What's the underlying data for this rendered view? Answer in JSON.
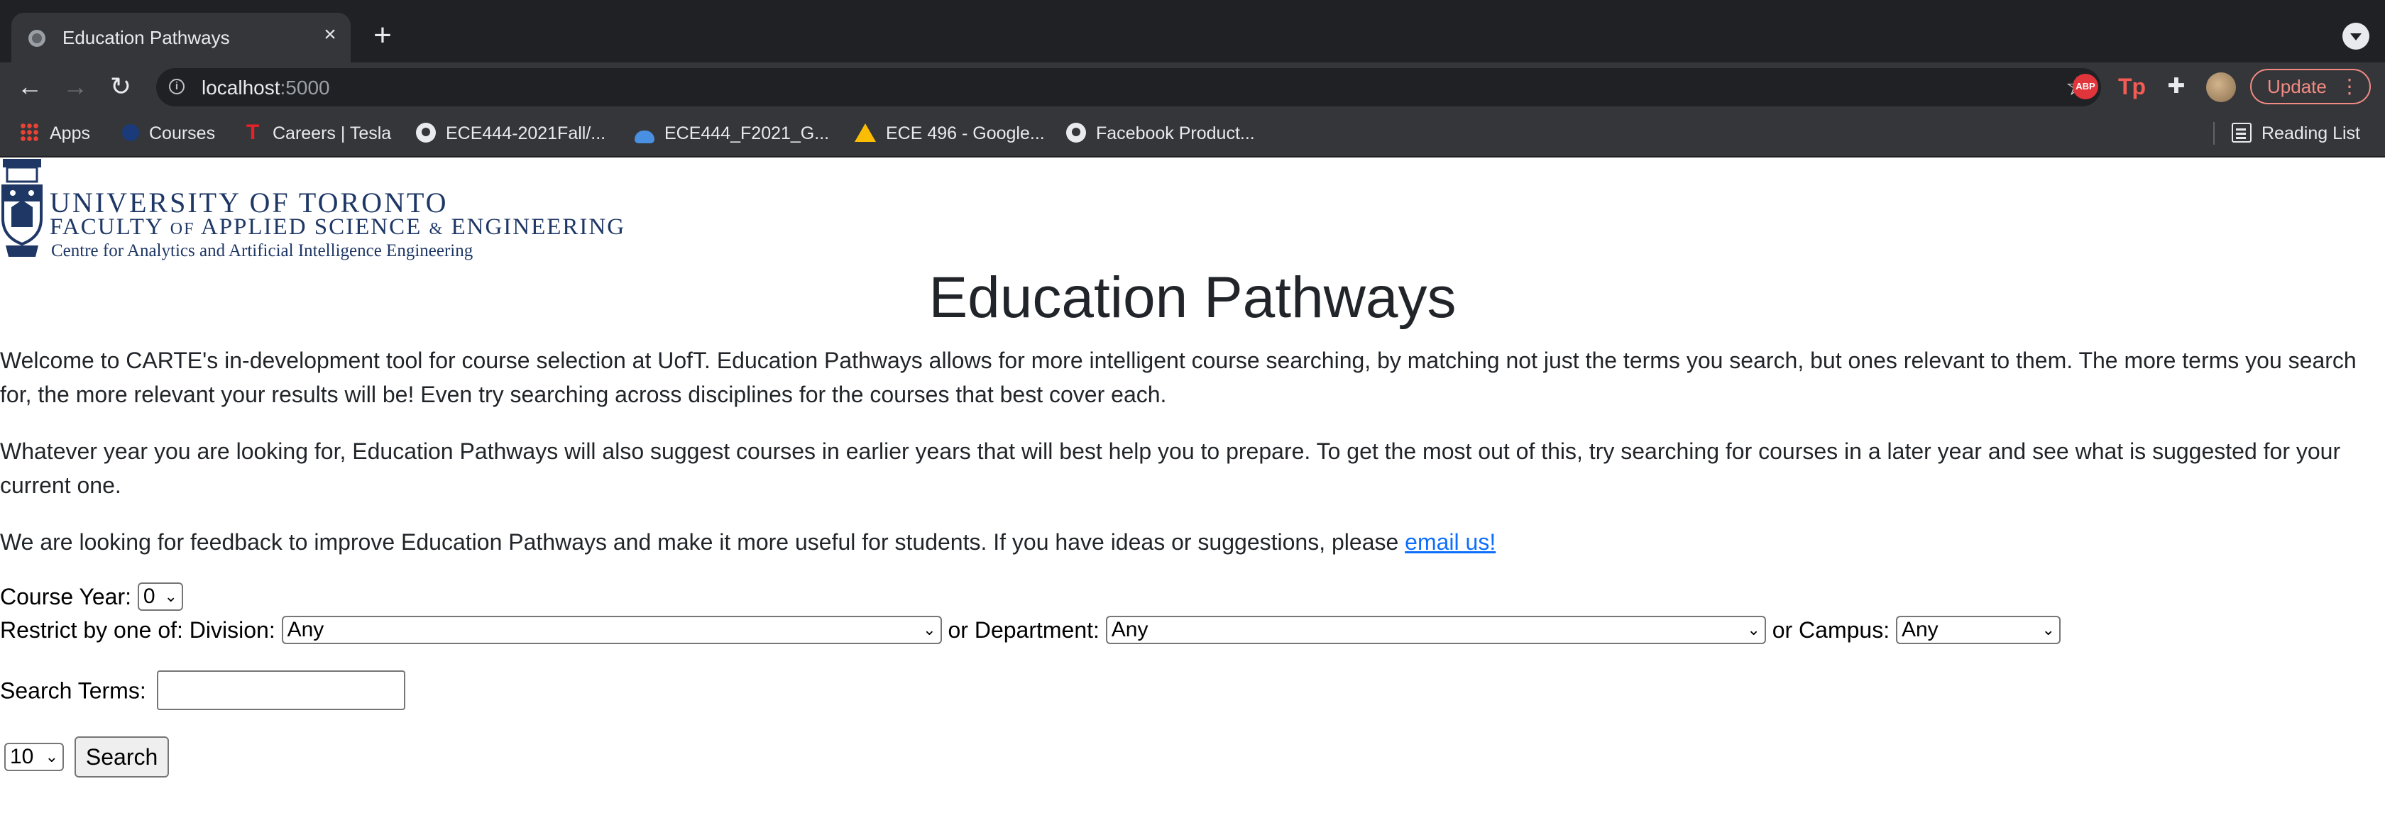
{
  "browser": {
    "tab_title": "Education Pathways",
    "url_host": "localhost",
    "url_port": ":5000",
    "update_label": "Update",
    "bookmarks": [
      {
        "label": "Apps",
        "icon": "apps-grid-icon"
      },
      {
        "label": "Courses",
        "icon": "courses-icon"
      },
      {
        "label": "Careers | Tesla",
        "icon": "tesla-icon"
      },
      {
        "label": "ECE444-2021Fall/...",
        "icon": "github-icon"
      },
      {
        "label": "ECE444_F2021_G...",
        "icon": "cloud-icon"
      },
      {
        "label": "ECE 496 - Google...",
        "icon": "google-drive-icon"
      },
      {
        "label": "Facebook Product...",
        "icon": "github-icon"
      }
    ],
    "reading_list_label": "Reading List",
    "extensions": {
      "abp": "ABP",
      "tp": "Tp"
    }
  },
  "logo": {
    "university": "UNIVERSITY OF TORONTO",
    "faculty_a": "FACULTY",
    "faculty_of": "OF",
    "faculty_b": "APPLIED SCIENCE",
    "faculty_amp": "&",
    "faculty_c": "ENGINEERING",
    "centre": "Centre for Analytics and Artificial Intelligence Engineering"
  },
  "page": {
    "title": "Education Pathways",
    "para1": "Welcome to CARTE's in-development tool for course selection at UofT. Education Pathways allows for more intelligent course searching, by matching not just the terms you search, but ones relevant to them. The more terms you search for, the more relevant your results will be! Even try searching across disciplines for the courses that best cover each.",
    "para2": "Whatever year you are looking for, Education Pathways will also suggest courses in earlier years that will best help you to prepare. To get the most out of this, try searching for courses in a later year and see what is suggested for your current one.",
    "para3_text": "We are looking for feedback to improve Education Pathways and make it more useful for students. If you have ideas or suggestions, please ",
    "para3_link": "email us!"
  },
  "form": {
    "course_year_label": "Course Year:",
    "course_year_value": "0",
    "restrict_label": "Restrict by one of: Division:",
    "division_value": "Any",
    "department_label": "or Department:",
    "department_value": "Any",
    "campus_label": "or Campus:",
    "campus_value": "Any",
    "search_terms_label": "Search Terms:",
    "search_terms_value": "",
    "results_count_value": "10",
    "search_button": "Search"
  },
  "colors": {
    "link": "#0d6efd",
    "uoft_blue": "#1e3765",
    "update_accent": "#f28b82"
  }
}
